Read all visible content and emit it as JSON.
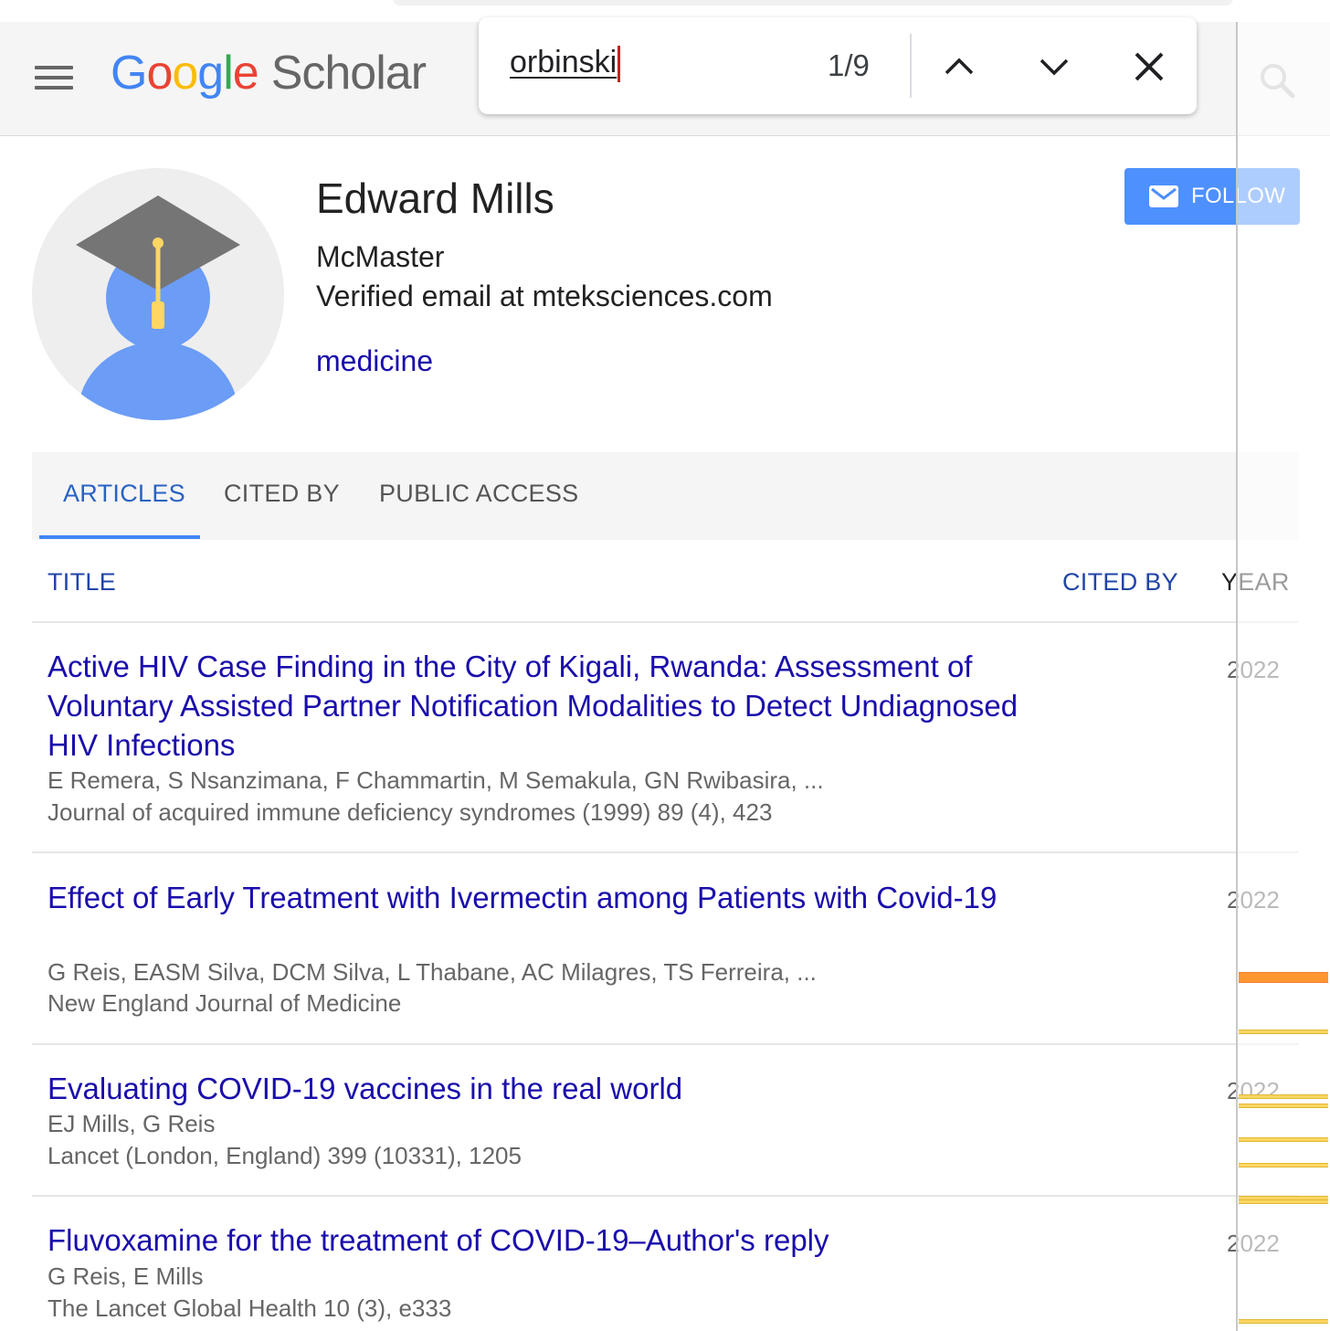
{
  "header": {
    "logo": {
      "g1": "G",
      "o1": "o",
      "o2": "o",
      "g2": "g",
      "l": "l",
      "e": "e",
      "scholar": "Scholar"
    }
  },
  "find_bar": {
    "query": "orbinski",
    "match_count": "1/9"
  },
  "profile": {
    "name": "Edward Mills",
    "affiliation": "McMaster",
    "email": "Verified email at mteksciences.com",
    "interest": "medicine",
    "follow_label": "FOLLOW"
  },
  "tabs": [
    {
      "label": "ARTICLES",
      "active": true
    },
    {
      "label": "CITED BY",
      "active": false
    },
    {
      "label": "PUBLIC ACCESS",
      "active": false
    }
  ],
  "table": {
    "col_title": "TITLE",
    "col_cited_by": "CITED BY",
    "col_year": "YEAR",
    "articles": [
      {
        "title": "Active HIV Case Finding in the City of Kigali, Rwanda: Assessment of Voluntary Assisted Partner Notification Modalities to Detect Undiagnosed HIV Infections",
        "authors": "E Remera, S Nsanzimana, F Chammartin, M Semakula, GN Rwibasira, ...",
        "venue": "Journal of acquired immune deficiency syndromes (1999) 89 (4), 423",
        "year": "2022"
      },
      {
        "title": "Effect of Early Treatment with Ivermectin among Patients with Covid-19",
        "authors": "G Reis, EASM Silva, DCM Silva, L Thabane, AC Milagres, TS Ferreira, ...",
        "venue": "New England Journal of Medicine",
        "year": "2022"
      },
      {
        "title": "Evaluating COVID-19 vaccines in the real world",
        "authors": "EJ Mills, G Reis",
        "venue": "Lancet (London, England) 399 (10331), 1205",
        "year": "2022"
      },
      {
        "title": "Fluvoxamine for the treatment of COVID-19–Author's reply",
        "authors": "G Reis, E Mills",
        "venue": "The Lancet Global Health 10 (3), e333",
        "year": "2022"
      }
    ]
  },
  "colors": {
    "link_blue": "#1a0dab",
    "follow_button": "#4d90fe",
    "current_match": "#ff9632",
    "other_match": "#fdd663"
  }
}
